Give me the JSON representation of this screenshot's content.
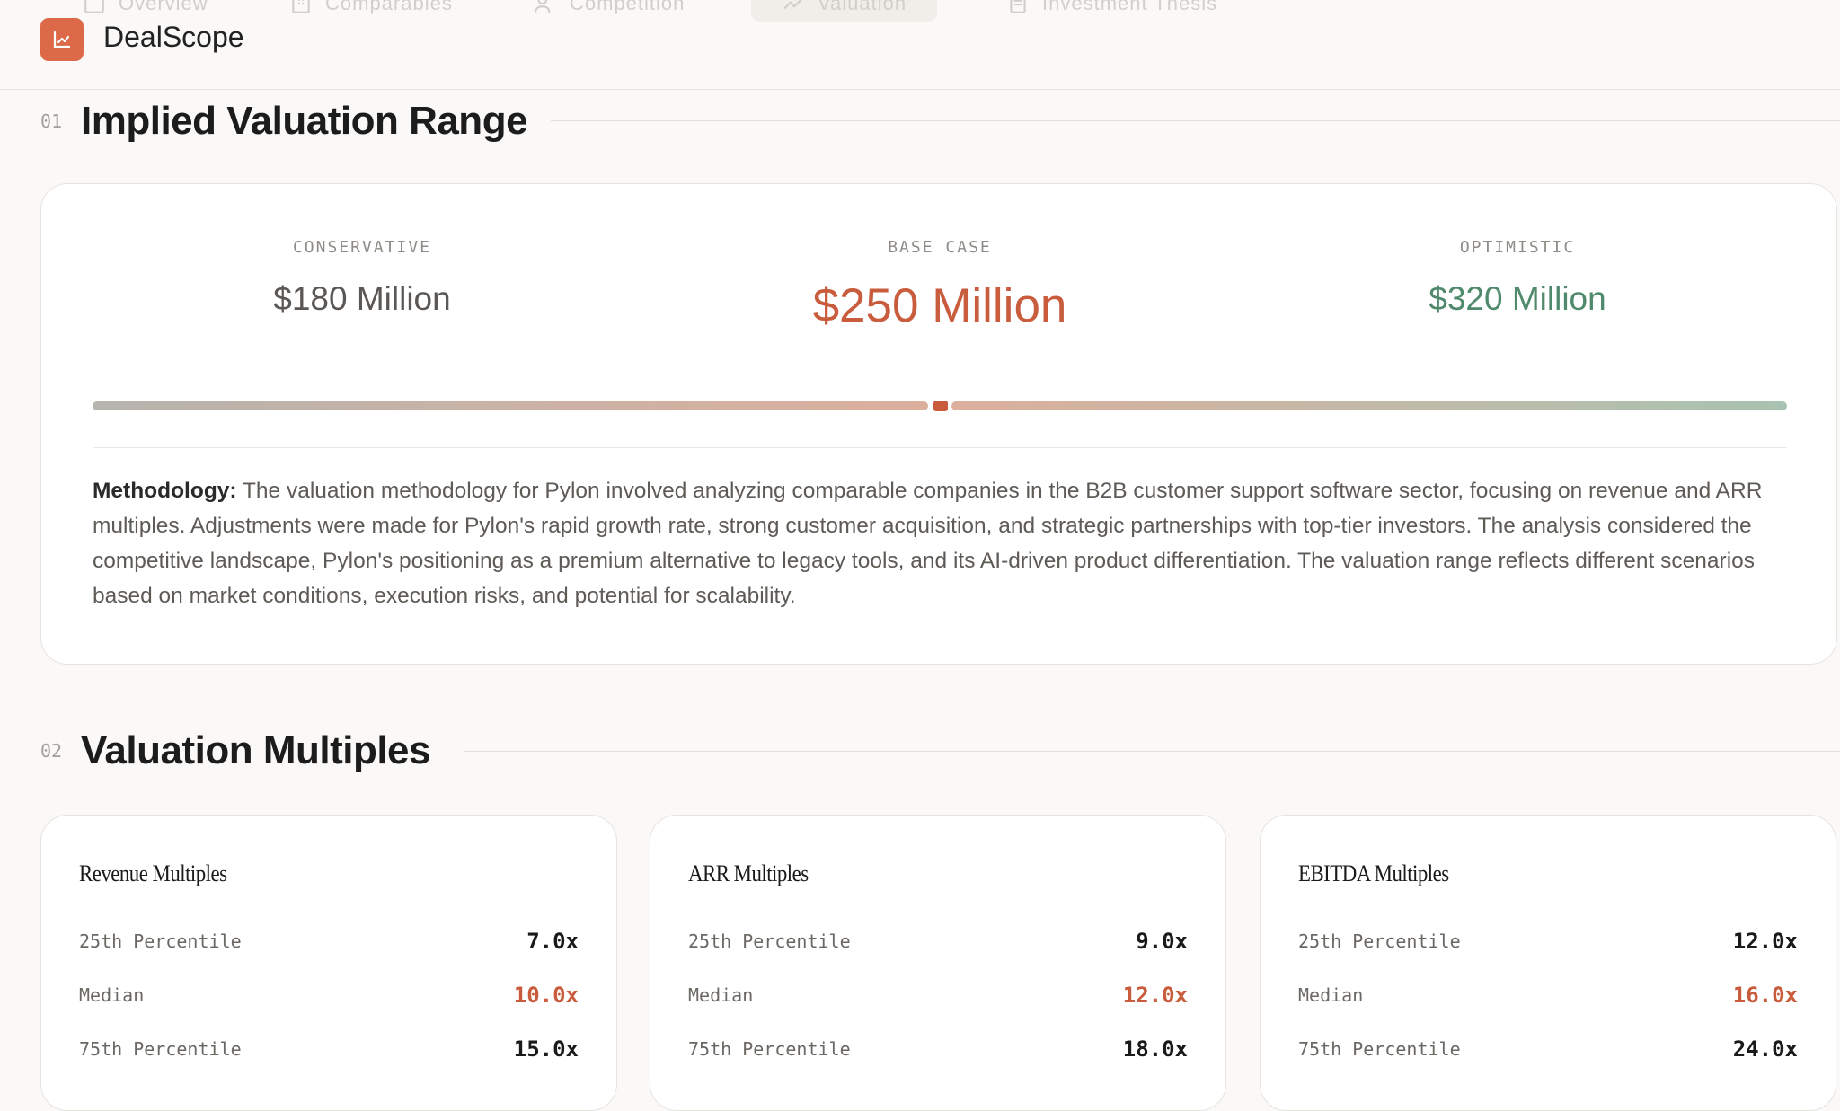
{
  "app": {
    "name": "DealScope"
  },
  "tabs": [
    {
      "label": "Overview",
      "icon": "layout-icon",
      "active": false
    },
    {
      "label": "Comparables",
      "icon": "building-icon",
      "active": false
    },
    {
      "label": "Competition",
      "icon": "users-icon",
      "active": false
    },
    {
      "label": "Valuation",
      "icon": "trending-up-icon",
      "active": true
    },
    {
      "label": "Investment Thesis",
      "icon": "document-icon",
      "active": false
    }
  ],
  "sections": {
    "valuation_range": {
      "number": "01",
      "title": "Implied Valuation Range"
    },
    "multiples": {
      "number": "02",
      "title": "Valuation Multiples"
    }
  },
  "valuation": {
    "conservative": {
      "label": "CONSERVATIVE",
      "value": "$180 Million"
    },
    "base": {
      "label": "BASE CASE",
      "value": "$250 Million"
    },
    "optimistic": {
      "label": "OPTIMISTIC",
      "value": "$320 Million"
    },
    "methodology_label": "Methodology:",
    "methodology_text": "The valuation methodology for Pylon involved analyzing comparable companies in the B2B customer support software sector, focusing on revenue and ARR multiples. Adjustments were made for Pylon's rapid growth rate, strong customer acquisition, and strategic partnerships with top-tier investors. The analysis considered the competitive landscape, Pylon's positioning as a premium alternative to legacy tools, and its AI-driven product differentiation. The valuation range reflects different scenarios based on market conditions, execution risks, and potential for scalability."
  },
  "multiples": [
    {
      "title": "Revenue Multiples",
      "rows": [
        {
          "label": "25th Percentile",
          "value": "7.0x"
        },
        {
          "label": "Median",
          "value": "10.0x"
        },
        {
          "label": "75th Percentile",
          "value": "15.0x"
        }
      ]
    },
    {
      "title": "ARR Multiples",
      "rows": [
        {
          "label": "25th Percentile",
          "value": "9.0x"
        },
        {
          "label": "Median",
          "value": "12.0x"
        },
        {
          "label": "75th Percentile",
          "value": "18.0x"
        }
      ]
    },
    {
      "title": "EBITDA Multiples",
      "rows": [
        {
          "label": "25th Percentile",
          "value": "12.0x"
        },
        {
          "label": "Median",
          "value": "16.0x"
        },
        {
          "label": "75th Percentile",
          "value": "24.0x"
        }
      ]
    }
  ],
  "colors": {
    "accent": "#c85c3c",
    "positive": "#4f8a6c",
    "logo": "#dc6a49"
  }
}
